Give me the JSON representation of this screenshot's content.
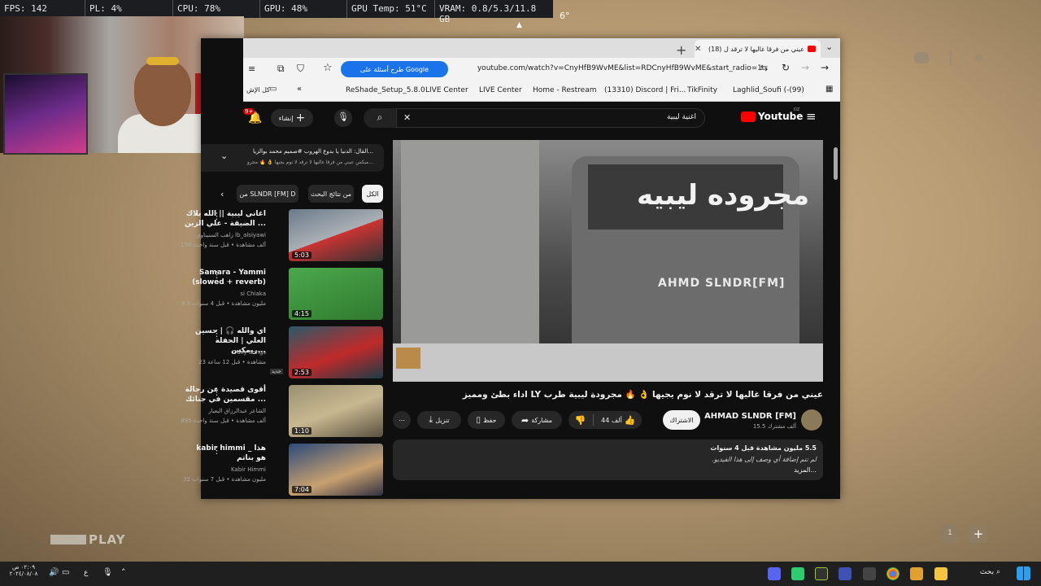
{
  "stats": {
    "fps": "FPS: 142",
    "pl": "PL: 4%",
    "cpu": "CPU: 78%",
    "gpu": "GPU: 48%",
    "gputemp": "GPU Temp: 51°C",
    "vram": "VRAM: 0.8/5.3/11.8 GB",
    "num": "6°"
  },
  "browser": {
    "tab_title": "(18) عيني من فرقا غاليها لا ترقد ل",
    "url": "youtube.com/watch?v=CnyHfB9WvME&list=RDCnyHfB9WvME&start_radio=1",
    "google_chip": "طرح أسئلة على Google",
    "bookmarks": [
      "ReShade_Setup_5.8.0",
      "LIVE Center",
      "LIVE Center",
      "Home - Restream",
      "(13310) Discord | Fri...",
      "TikFinity",
      "Laghlid_Soufi (-(99)",
      "كل الإش"
    ]
  },
  "youtube": {
    "logo": "Youtube",
    "logo_sup": "DZ",
    "search_query": "اغنية ليبية",
    "create_label": "إنشاء",
    "notif_count": "9+",
    "video_title": "عيني من فرقا غاليها لا ترقد لا نوم يجيها 👌 🔥 مجرودة ليبية طرب LY اداء بطئ ومميز",
    "channel": "AHMAD SLNDR [FM]",
    "subs": "15.5 ألف مشترك",
    "subscribe": "الاشتراك",
    "likes": "44 ألف",
    "share": "مشاركة",
    "save": "حفظ",
    "download": "تنزيل",
    "desc_views": "5.5 مليون مشاهدة قبل 4 سنوات",
    "desc_text": "لم تتم إضافة أي وصف إلى هذا الفيديو.",
    "desc_more": "...المزيد",
    "player_text": "مجروده ليبيه",
    "player_watermark": "AHMD SLNDR[FM]",
    "playlist_title": "القال: الدنيا يا بدوع الهروب #صميم محمد بوالزيا...",
    "playlist_sub": "ميكس عيني من فرقا غاليها لا ترقد لا نوم يجيها 👌 🔥 مجرو...",
    "chips": [
      "الكل",
      "من نتائج البحث",
      "من SLNDR [FM] D"
    ],
    "recs": [
      {
        "title": "اغاني ليبية || الله يلاك الضيقة - علي الزين ...",
        "channel": "زاهب السنيناوي lb_alsiyawi",
        "meta": "190 ألف مشاهدة • قبل سنة واحدة",
        "dur": "5:03"
      },
      {
        "title": "Samara - Yammi (slowed + reverb)",
        "channel": "si Chiaka",
        "meta": "3.9 مليون مشاهدة • قبل 4 سنوات",
        "dur": "4:15"
      },
      {
        "title": "اي والله 🎧 | حسين العلي | الحفلة ريمكس...",
        "channel": "Daily Songs",
        "meta": "23 مشاهدة • قبل 12 ساعة",
        "dur": "2:53",
        "badge": "جديد"
      },
      {
        "title": "أقوى قصيدة عن رجالة مقسمين في جنائك ...",
        "channel": "الشاعر عبدالرزاق البعيار",
        "meta": "895 ألف مشاهدة • قبل سنة واحدة",
        "dur": "1:10"
      },
      {
        "title": "kabir himmi _ هذا هو بناتم",
        "channel": "Kabir Himmi",
        "meta": "32 مليون مشاهدة • قبل 7 سنوات",
        "dur": "7:04"
      }
    ]
  },
  "desktop": {
    "play_logo": "PLAY",
    "page_num": "1",
    "clock_time": "٠٢:٠٩ ص",
    "clock_date": "٢٠٢٤/٠٨/٠٨",
    "search": "بحث",
    "lang": "ع"
  },
  "colors": {
    "accent": "#ff0000",
    "yt_bg": "#0f0f0f",
    "chip_bg": "#272727"
  }
}
